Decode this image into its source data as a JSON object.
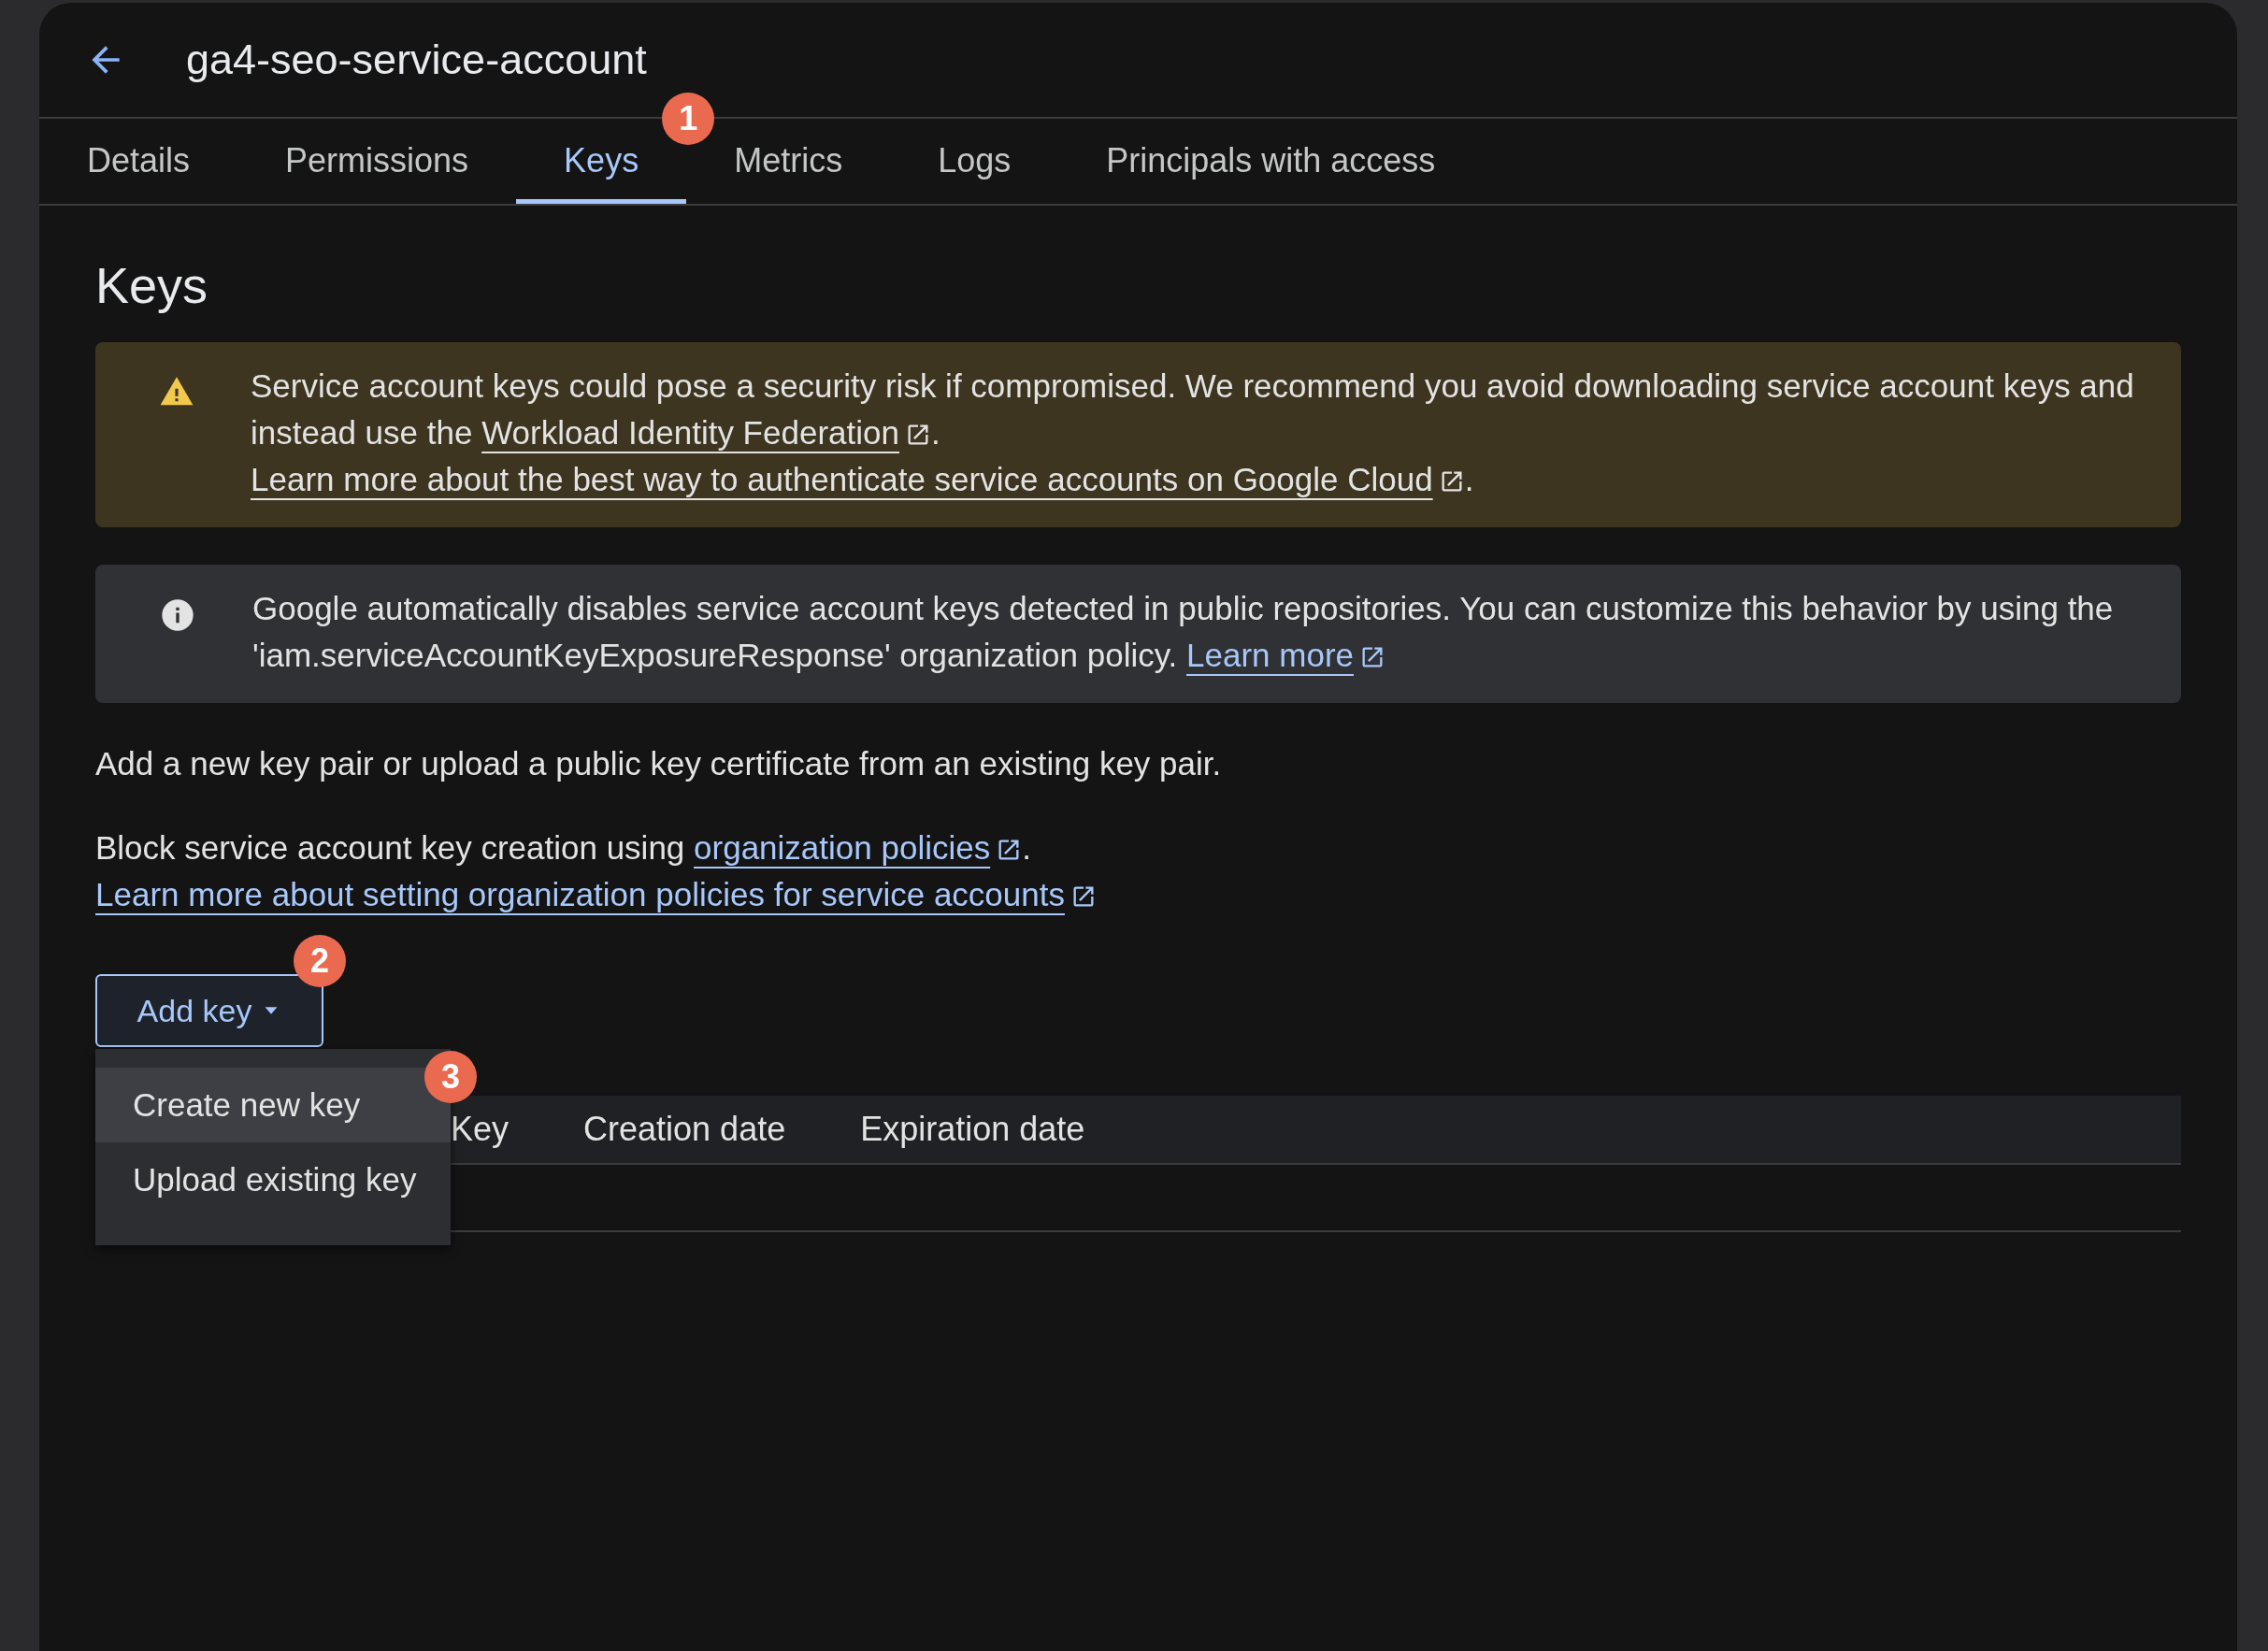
{
  "header": {
    "title": "ga4-seo-service-account"
  },
  "tabs": [
    {
      "label": "Details",
      "selected": false
    },
    {
      "label": "Permissions",
      "selected": false
    },
    {
      "label": "Keys",
      "selected": true,
      "annotation": "1"
    },
    {
      "label": "Metrics",
      "selected": false
    },
    {
      "label": "Logs",
      "selected": false
    },
    {
      "label": "Principals with access",
      "selected": false
    }
  ],
  "page_title": "Keys",
  "banners": [
    {
      "kind": "warning",
      "segments": [
        {
          "kind": "text",
          "text": "Service account keys could pose a security risk if compromised. We recommend you avoid downloading service account keys and instead use the "
        },
        {
          "kind": "link",
          "text": "Workload Identity Federation",
          "external": true
        },
        {
          "kind": "text",
          "text": ". "
        },
        {
          "kind": "link",
          "text": "Learn more about the best way to authenticate service accounts on Google Cloud",
          "external": true
        },
        {
          "kind": "text",
          "text": "."
        }
      ]
    },
    {
      "kind": "info",
      "segments": [
        {
          "kind": "text",
          "text": "Google automatically disables service account keys detected in public repositories. You can customize this behavior by using the 'iam.serviceAccountKeyExposureResponse' organization policy. "
        },
        {
          "kind": "link",
          "text": "Learn more",
          "external": true
        }
      ]
    }
  ],
  "paragraphs": [
    {
      "segments": [
        {
          "kind": "text",
          "text": "Add a new key pair or upload a public key certificate from an existing key pair."
        }
      ]
    },
    {
      "segments": [
        {
          "kind": "text",
          "text": "Block service account key creation using "
        },
        {
          "kind": "link",
          "text": "organization policies",
          "external": true
        },
        {
          "kind": "text",
          "text": "."
        }
      ]
    },
    {
      "segments": [
        {
          "kind": "link",
          "text": "Learn more about setting organization policies for service accounts",
          "external": true
        }
      ]
    }
  ],
  "add_key_button": {
    "label": "Add key",
    "annotation": "2"
  },
  "menu": {
    "annotation": "3",
    "items": [
      {
        "label": "Create new key",
        "highlighted": true
      },
      {
        "label": "Upload existing key",
        "highlighted": false
      }
    ]
  },
  "table": {
    "columns": [
      "Key",
      "Creation date",
      "Expiration date"
    ]
  }
}
